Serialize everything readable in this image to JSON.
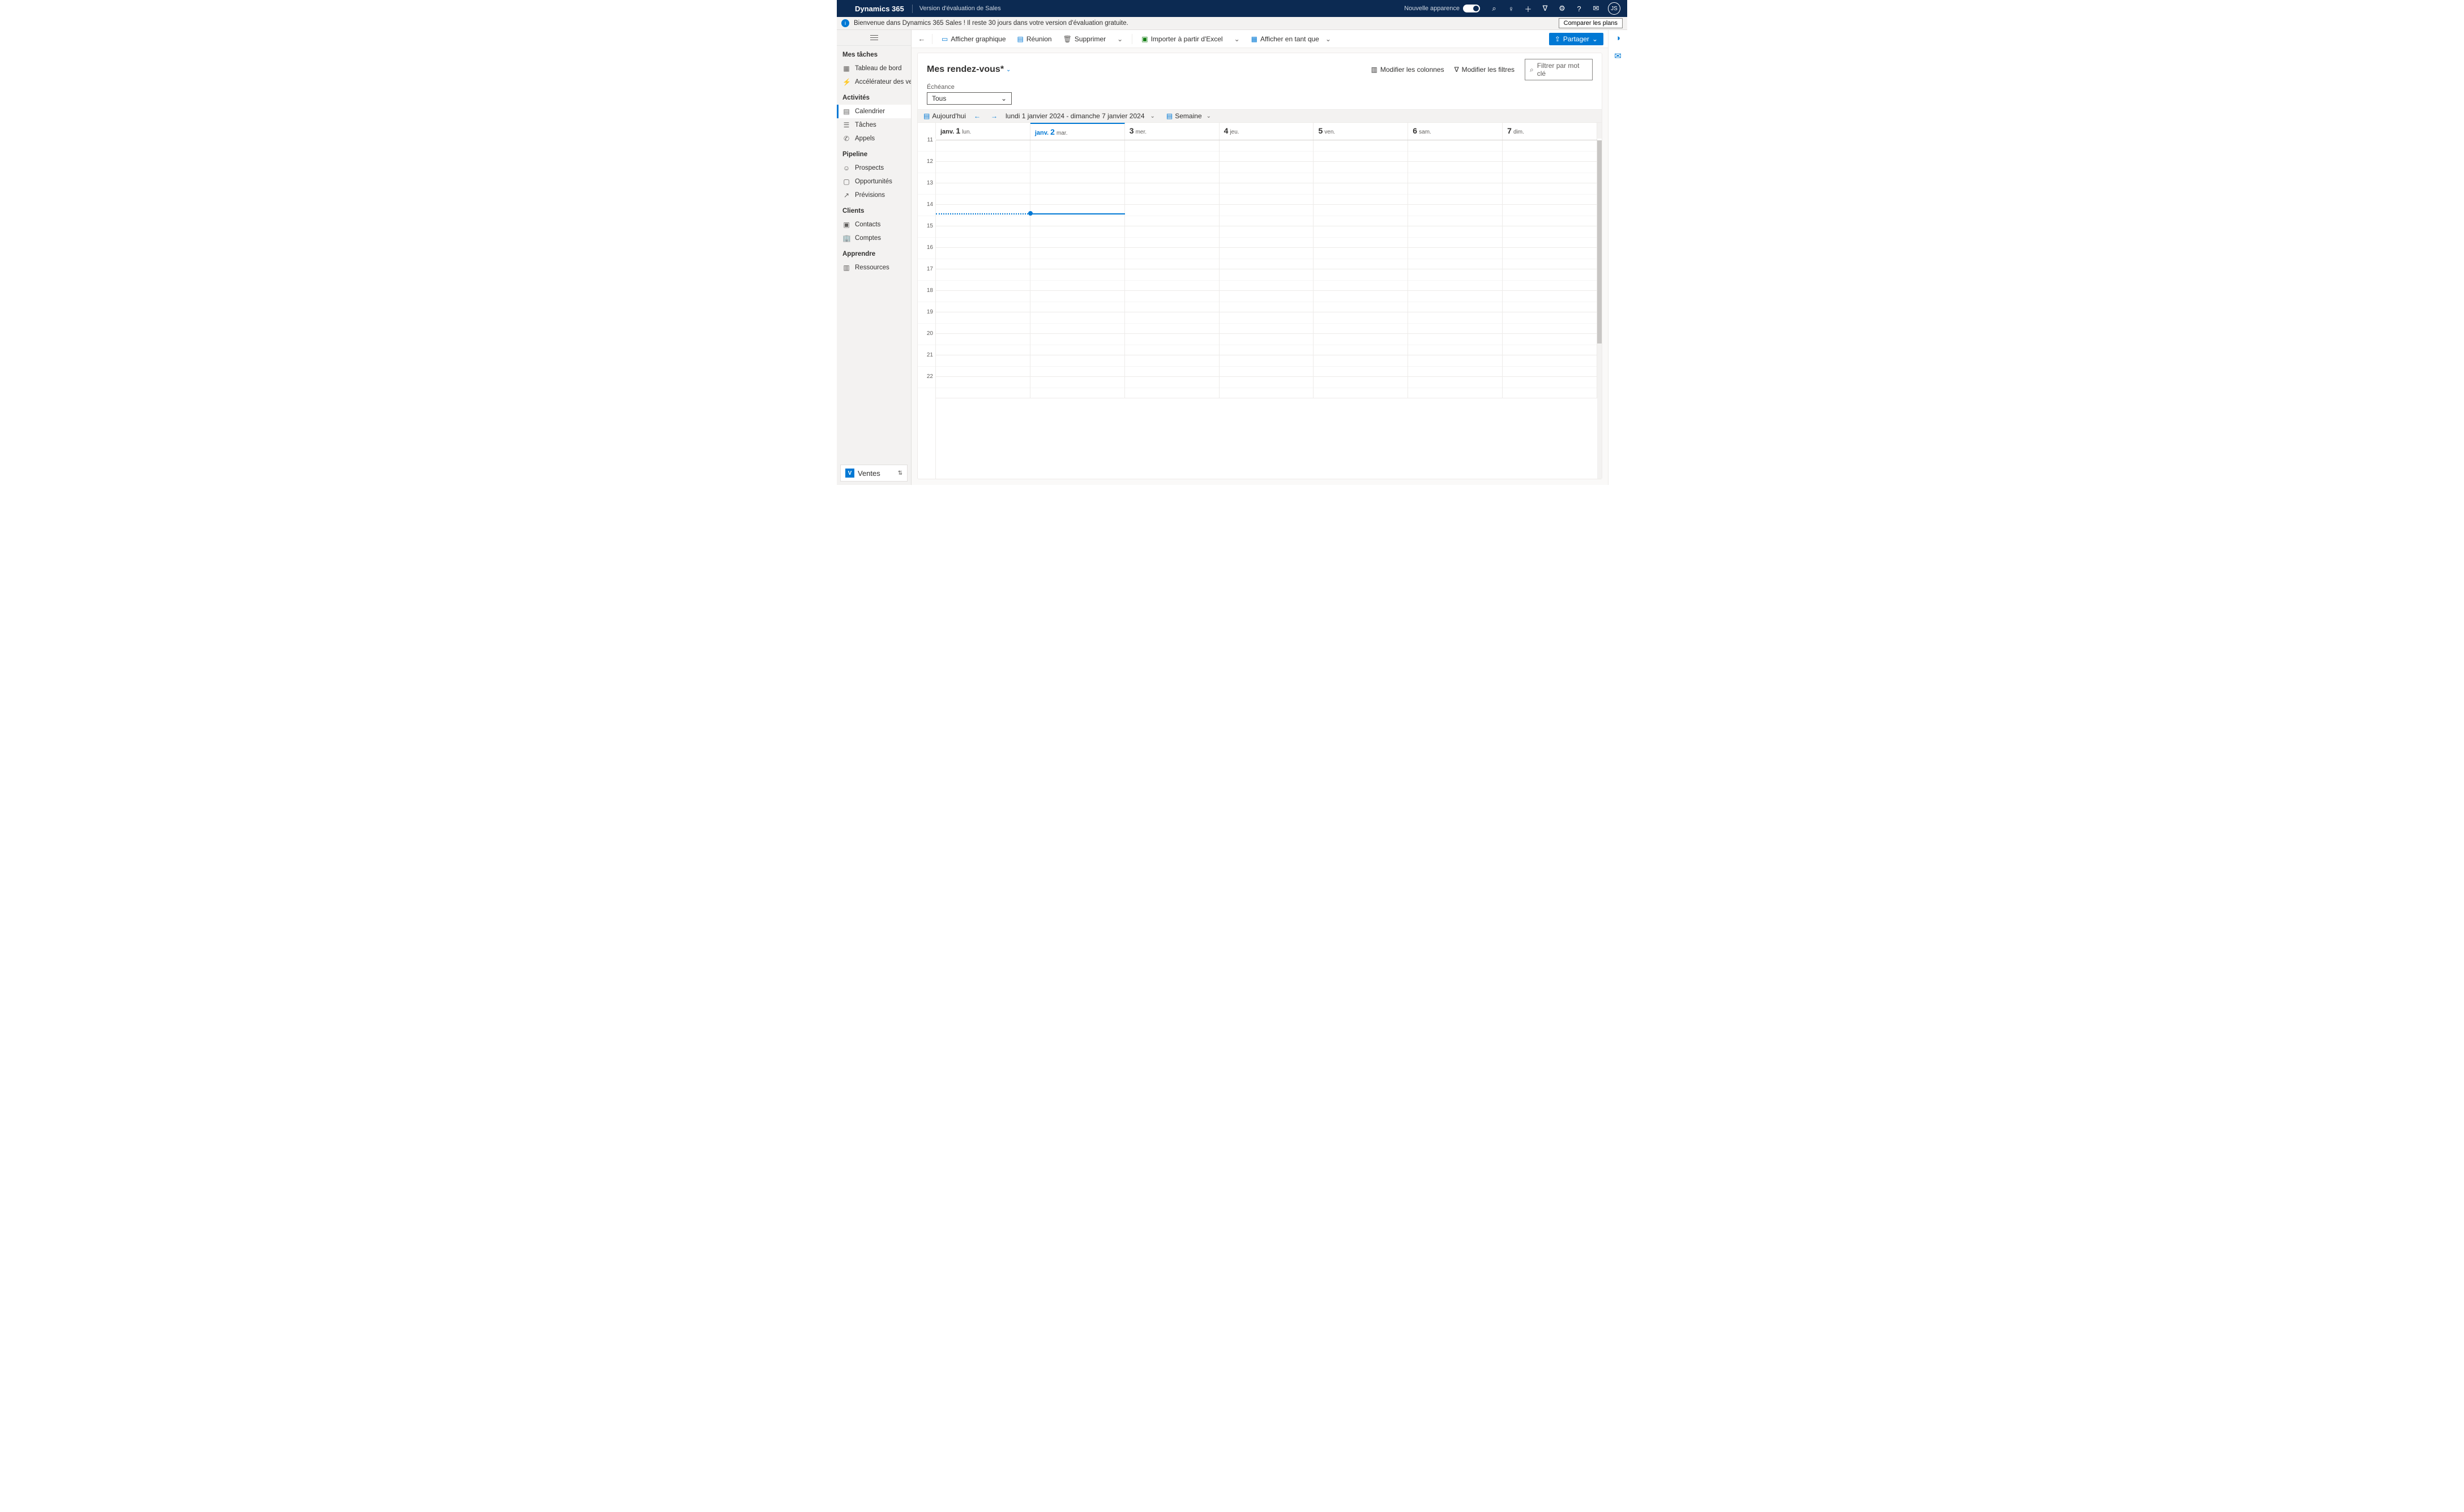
{
  "header": {
    "product": "Dynamics 365",
    "environment": "Version d'évaluation de Sales",
    "new_look_label": "Nouvelle apparence",
    "avatar_initials": "JS"
  },
  "banner": {
    "text": "Bienvenue dans Dynamics 365 Sales ! Il reste 30 jours dans votre version d'évaluation gratuite.",
    "compare_button": "Comparer les plans"
  },
  "sidebar": {
    "groups": {
      "tasks": "Mes tâches",
      "activities": "Activités",
      "pipeline": "Pipeline",
      "clients": "Clients",
      "learn": "Apprendre"
    },
    "items": {
      "dashboard": "Tableau de bord",
      "accelerator": "Accélérateur des ven…",
      "calendar": "Calendrier",
      "tasks": "Tâches",
      "calls": "Appels",
      "prospects": "Prospects",
      "opportunities": "Opportunités",
      "forecasts": "Prévisions",
      "contacts": "Contacts",
      "accounts": "Comptes",
      "resources": "Ressources"
    },
    "app_switch_label": "Ventes",
    "app_switch_letter": "V"
  },
  "commandbar": {
    "show_chart": "Afficher graphique",
    "meeting": "Réunion",
    "delete": "Supprimer",
    "import_excel": "Importer à partir d'Excel",
    "show_as": "Afficher en tant que",
    "share": "Partager"
  },
  "page": {
    "title": "Mes rendez-vous*",
    "edit_columns": "Modifier les colonnes",
    "edit_filters": "Modifier les filtres",
    "keyword_placeholder": "Filtrer par mot clé",
    "filter_label": "Échéance",
    "filter_value": "Tous"
  },
  "calendar": {
    "today_button": "Aujourd'hui",
    "range": "lundi 1 janvier 2024 - dimanche 7 janvier 2024",
    "view_label": "Semaine",
    "days": [
      {
        "prefix": "janv.",
        "num": "1",
        "abbr": "lun."
      },
      {
        "prefix": "janv.",
        "num": "2",
        "abbr": "mar."
      },
      {
        "prefix": "",
        "num": "3",
        "abbr": "mer."
      },
      {
        "prefix": "",
        "num": "4",
        "abbr": "jeu."
      },
      {
        "prefix": "",
        "num": "5",
        "abbr": "ven."
      },
      {
        "prefix": "",
        "num": "6",
        "abbr": "sam."
      },
      {
        "prefix": "",
        "num": "7",
        "abbr": "dim."
      }
    ],
    "hours": [
      "11",
      "12",
      "13",
      "14",
      "15",
      "16",
      "17",
      "18",
      "19",
      "20",
      "21",
      "22"
    ]
  }
}
